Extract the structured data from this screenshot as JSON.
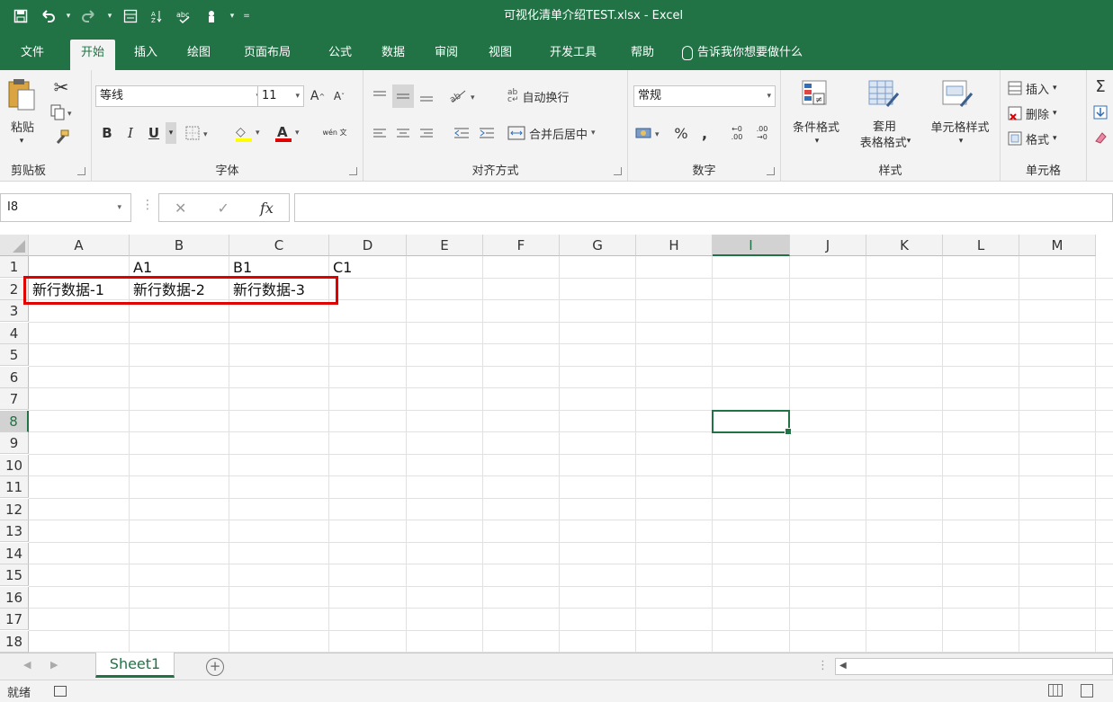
{
  "window": {
    "title": "可视化清单介绍TEST.xlsx  -  Excel"
  },
  "tabs": [
    "文件",
    "开始",
    "插入",
    "绘图",
    "页面布局",
    "公式",
    "数据",
    "审阅",
    "视图",
    "开发工具",
    "帮助"
  ],
  "active_tab": "开始",
  "tell_me": "告诉我你想要做什么",
  "ribbon": {
    "clipboard": {
      "paste": "粘贴",
      "label": "剪贴板"
    },
    "font": {
      "name": "等线",
      "size": "11",
      "bold": "B",
      "italic": "I",
      "underline": "U",
      "grow": "A",
      "shrink": "A",
      "fill_color_glyph": "◇",
      "font_color": "A",
      "phonetic": "wén 文",
      "label": "字体"
    },
    "alignment": {
      "wrap": "自动换行",
      "merge": "合并后居中",
      "label": "对齐方式"
    },
    "number": {
      "format": "常规",
      "percent": "%",
      "comma": ",",
      "inc_decimal": "←0 .00",
      "dec_decimal": ".00 →0",
      "label": "数字"
    },
    "styles": {
      "conditional": "条件格式",
      "table_format_1": "套用",
      "table_format_2": "表格格式",
      "cell_styles": "单元格样式",
      "label": "样式"
    },
    "cells": {
      "insert": "插入",
      "delete": "删除",
      "format": "格式",
      "label": "单元格"
    }
  },
  "formula_bar": {
    "name_box": "I8",
    "cancel": "✕",
    "enter": "✓",
    "fx": "fx",
    "value": ""
  },
  "columns": [
    "A",
    "B",
    "C",
    "D",
    "E",
    "F",
    "G",
    "H",
    "I",
    "J",
    "K",
    "L",
    "M"
  ],
  "selected_column": "I",
  "rows": [
    "1",
    "2",
    "3",
    "4",
    "5",
    "6",
    "7",
    "8",
    "9",
    "10",
    "11",
    "12",
    "13",
    "14",
    "15",
    "16",
    "17",
    "18"
  ],
  "selected_row": "8",
  "cells": {
    "B1": "A1",
    "C1": "B1",
    "D1": "C1",
    "A2": "新行数据-1",
    "B2": "新行数据-2",
    "C2": "新行数据-3"
  },
  "sheets": [
    "Sheet1"
  ],
  "status": {
    "text": "就绪"
  },
  "colors": {
    "accent": "#217346",
    "highlight": "#e00000"
  }
}
